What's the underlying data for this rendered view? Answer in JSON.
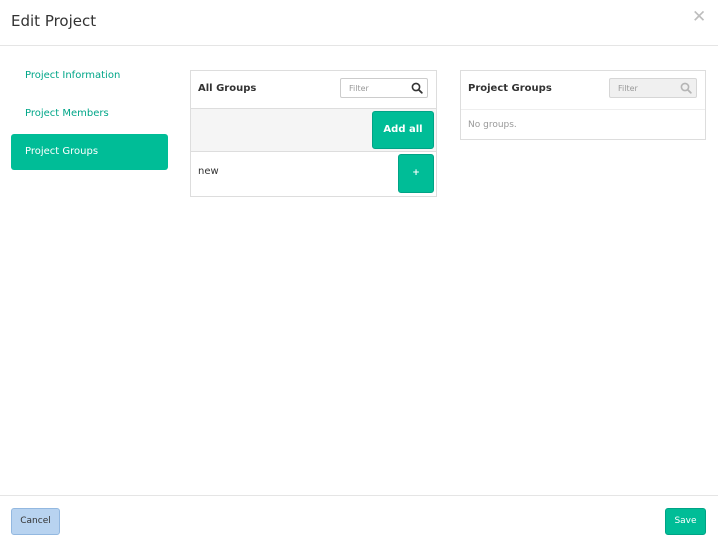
{
  "dialog": {
    "title": "Edit Project",
    "close_icon": "close-icon"
  },
  "nav": {
    "items": [
      {
        "label": "Project Information",
        "active": false
      },
      {
        "label": "Project Members",
        "active": false
      },
      {
        "label": "Project Groups",
        "active": true
      }
    ]
  },
  "all_groups": {
    "title": "All Groups",
    "filter_placeholder": "Filter",
    "add_all_label": "Add all",
    "rows": [
      {
        "name": "new",
        "add_label": "+"
      }
    ]
  },
  "project_groups": {
    "title": "Project Groups",
    "filter_placeholder": "Filter",
    "empty_message": "No groups."
  },
  "footer": {
    "cancel_label": "Cancel",
    "save_label": "Save"
  },
  "colors": {
    "accent": "#00bd97",
    "cancel_bg": "#b8d3f0"
  }
}
